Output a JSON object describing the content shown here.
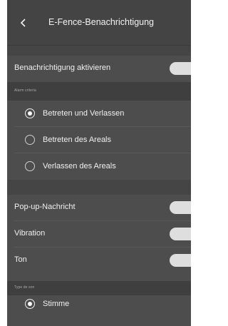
{
  "header": {
    "title": "E-Fence-Benachrichtigung",
    "back_icon": "chevron-left-icon"
  },
  "notification": {
    "label": "Benachrichtigung aktivieren",
    "enabled": true
  },
  "alarm_criteria": {
    "section_title": "Alarm criteria",
    "options": [
      {
        "label": "Betreten und Verlassen",
        "selected": true
      },
      {
        "label": "Betreten des Areals",
        "selected": false
      },
      {
        "label": "Verlassen des Areals",
        "selected": false
      }
    ]
  },
  "alerts": {
    "items": [
      {
        "label": "Pop-up-Nachricht",
        "enabled": true
      },
      {
        "label": "Vibration",
        "enabled": true
      },
      {
        "label": "Ton",
        "enabled": true
      }
    ]
  },
  "sound_type": {
    "section_title": "Type de son",
    "options": [
      {
        "label": "Stimme",
        "selected": true
      }
    ]
  },
  "colors": {
    "background": "#4d4d4d",
    "section_header": "#3f3f3f",
    "toggle_on": "#dedede",
    "text": "#f0f0f0"
  }
}
